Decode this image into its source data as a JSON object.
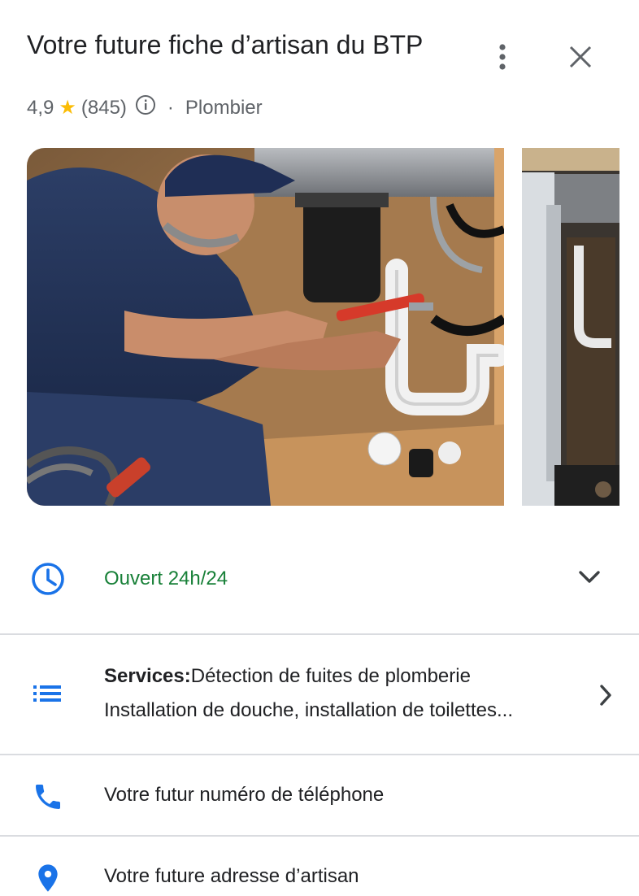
{
  "header": {
    "title": "Votre future fiche d’artisan du BTP",
    "rating": "4,9",
    "reviews": "(845)",
    "separator": "·",
    "category": "Plombier"
  },
  "icons": {
    "star": "star-icon",
    "info": "info-icon",
    "more": "more-vert-icon",
    "close": "close-icon",
    "clock": "clock-icon",
    "chevron_down": "chevron-down-icon",
    "list": "list-icon",
    "chevron_right": "chevron-right-icon",
    "phone": "phone-icon",
    "location": "location-pin-icon"
  },
  "colors": {
    "accent_blue": "#1a73e8",
    "open_green": "#188038",
    "star_yellow": "#fbbc04",
    "divider": "#dadce0"
  },
  "hours": {
    "status": "Ouvert 24h/24"
  },
  "services": {
    "label": "Services:",
    "line1": "Détection de fuites de plomberie",
    "line2": "Installation de douche, installation de toilettes..."
  },
  "phone": {
    "text": "Votre futur numéro de téléphone"
  },
  "address": {
    "text": "Votre future adresse d’artisan"
  }
}
